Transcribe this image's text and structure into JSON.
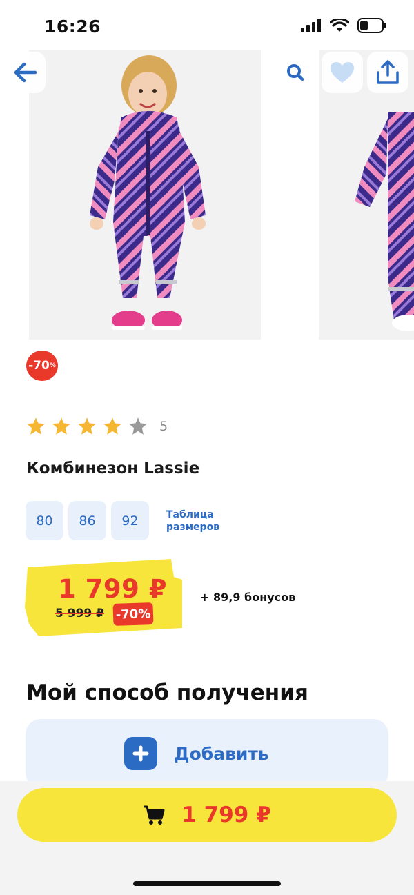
{
  "status_bar": {
    "time": "16:26"
  },
  "product": {
    "discount_badge": "-70",
    "discount_badge_percent": "%",
    "rating": 4,
    "rating_max": 5,
    "rating_count": "5",
    "title": "Комбинезон Lassie",
    "sizes": [
      "80",
      "86",
      "92"
    ],
    "size_table_label": "Таблица размеров"
  },
  "price": {
    "current": "1 799 ₽",
    "old": "5 999 ₽",
    "discount": "-70%",
    "bonus": "+ 89,9 бонусов"
  },
  "delivery": {
    "section_title": "Мой способ получения",
    "add_label": "Добавить"
  },
  "cart": {
    "price": "1 799 ₽"
  },
  "colors": {
    "accent_blue": "#2c6bc4",
    "sale_red": "#e8392b",
    "price_yellow": "#f8e53c",
    "chip_bg": "#e8f0fb"
  },
  "icons": [
    "back-arrow-icon",
    "search-icon",
    "heart-icon",
    "share-icon",
    "star-icon",
    "plus-icon",
    "cart-icon"
  ]
}
